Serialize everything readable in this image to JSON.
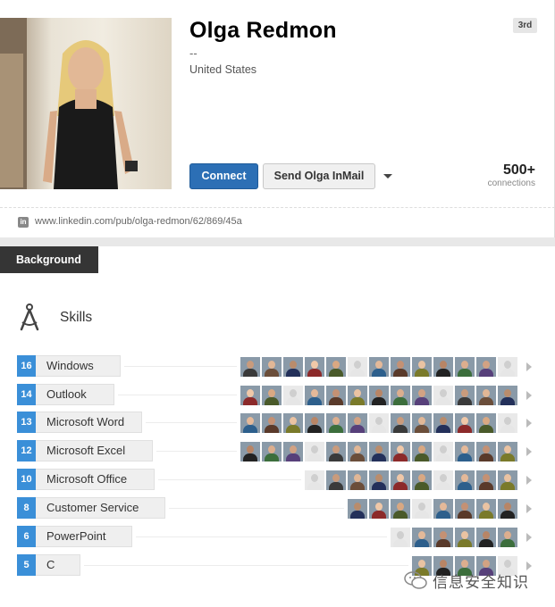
{
  "profile": {
    "name": "Olga Redmon",
    "headline": "--",
    "location": "United States",
    "degree": "3rd",
    "connect_label": "Connect",
    "inmail_label": "Send Olga InMail",
    "connections_count": "500+",
    "connections_label": "connections",
    "public_url": "www.linkedin.com/pub/olga-redmon/62/869/45a",
    "url_icon": "linkedin-icon"
  },
  "background": {
    "tab_label": "Background",
    "skills_title": "Skills",
    "skills_icon": "compass-icon"
  },
  "skills": [
    {
      "count": "16",
      "name": "Windows",
      "endorsers": 13
    },
    {
      "count": "14",
      "name": "Outlook",
      "endorsers": 13
    },
    {
      "count": "13",
      "name": "Microsoft Word",
      "endorsers": 13
    },
    {
      "count": "12",
      "name": "Microsoft Excel",
      "endorsers": 13
    },
    {
      "count": "10",
      "name": "Microsoft Office",
      "endorsers": 10
    },
    {
      "count": "8",
      "name": "Customer Service",
      "endorsers": 8
    },
    {
      "count": "6",
      "name": "PowerPoint",
      "endorsers": 6
    },
    {
      "count": "5",
      "name": "C",
      "endorsers": 5
    }
  ],
  "watermark": {
    "text": "信息安全知识",
    "icon": "wechat-icon"
  },
  "colors": {
    "connect_blue": "#2c6fb5",
    "count_badge_blue": "#3a8fd8",
    "tab_dark": "#353535"
  }
}
